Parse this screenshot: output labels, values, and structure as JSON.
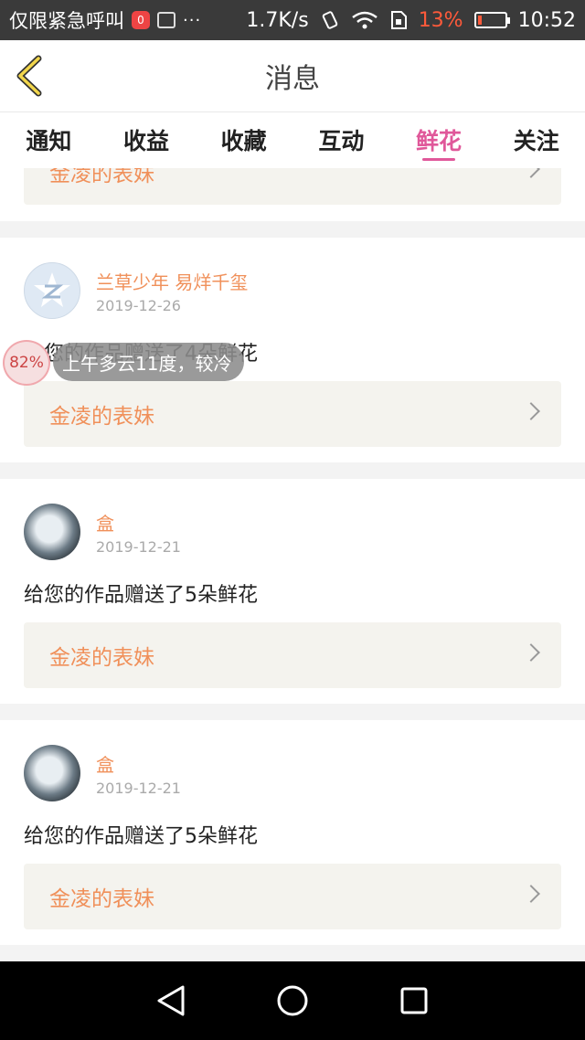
{
  "status_bar": {
    "app_text": "仅限紧急呼叫",
    "notif_badge": "0",
    "more": "···",
    "speed": "1.7K/s",
    "battery_pct": "13%",
    "battery_level": 0.13,
    "time": "10:52",
    "colors": {
      "background": "#3a3a3a",
      "battery_low": "#ff5a3a"
    }
  },
  "header": {
    "title": "消息",
    "back_icon": "chevron-left-icon"
  },
  "tabs": [
    {
      "label": "通知",
      "active": false
    },
    {
      "label": "收益",
      "active": false
    },
    {
      "label": "收藏",
      "active": false
    },
    {
      "label": "互动",
      "active": false
    },
    {
      "label": "鲜花",
      "active": true
    },
    {
      "label": "关注",
      "active": false
    }
  ],
  "accent_color": "#e0589a",
  "name_color": "#f0905a",
  "cards": [
    {
      "work_title": "金凌的表妹"
    },
    {
      "nick": "兰草少年 易烊千玺",
      "date": "2019-12-26",
      "message": "给您的作品赠送了4朵鲜花",
      "work_title": "金凌的表妹",
      "avatar": "qq-avatar"
    },
    {
      "nick": "盒",
      "date": "2019-12-21",
      "message": "给您的作品赠送了5朵鲜花",
      "work_title": "金凌的表妹",
      "avatar": "photo-avatar"
    },
    {
      "nick": "盒",
      "date": "2019-12-21",
      "message": "给您的作品赠送了5朵鲜花",
      "work_title": "金凌的表妹",
      "avatar": "photo-avatar"
    }
  ],
  "overlay": {
    "percent": "82%",
    "weather_text": "上午多云11度，较冷"
  }
}
